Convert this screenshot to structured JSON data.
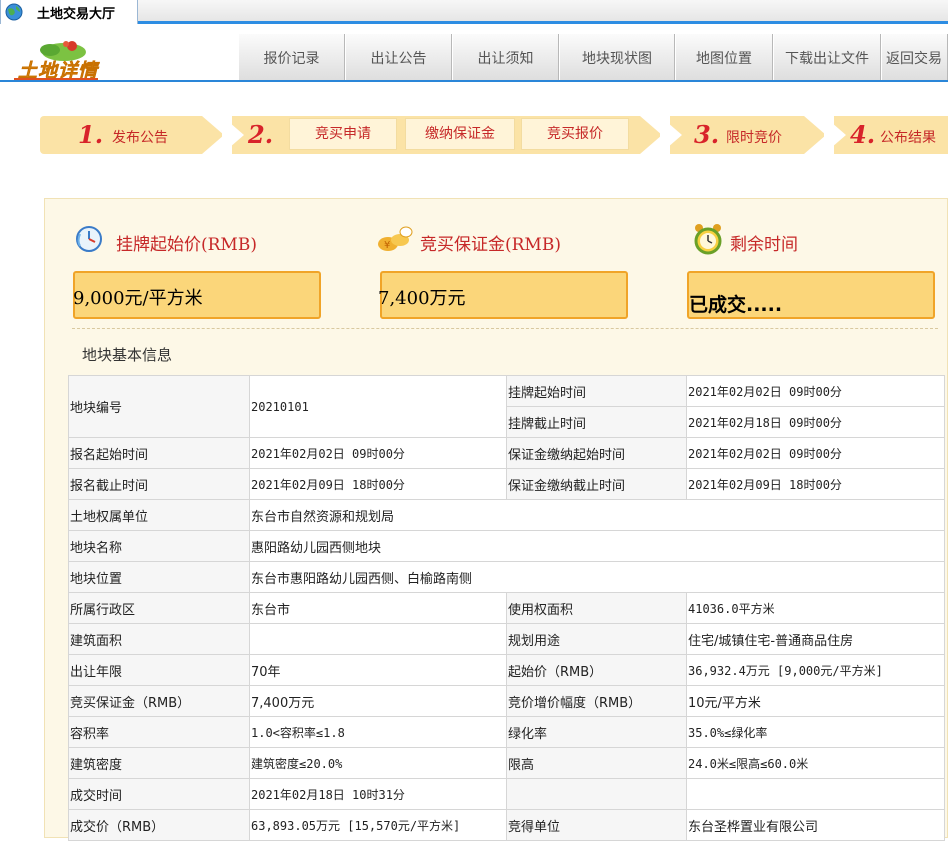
{
  "tab": {
    "title": "土地交易大厅"
  },
  "header": {
    "logo_text": "土地详情"
  },
  "nav": {
    "items": [
      {
        "label": "报价记录"
      },
      {
        "label": "出让公告"
      },
      {
        "label": "出让须知"
      },
      {
        "label": "地块现状图"
      },
      {
        "label": "地图位置"
      },
      {
        "label": "下载出让文件"
      },
      {
        "label": "返回交易"
      }
    ]
  },
  "steps": {
    "s1": {
      "num": "1.",
      "label": "发布公告"
    },
    "s2": {
      "num": "2.",
      "buttons": [
        "竞买申请",
        "缴纳保证金",
        "竞买报价"
      ]
    },
    "s3": {
      "num": "3.",
      "label": "限时竞价"
    },
    "s4": {
      "num": "4.",
      "label": "公布结果"
    }
  },
  "colors": {
    "accent": "#2a86d8",
    "step_bg": "#fbe3a6",
    "step_text": "#c62828",
    "box_fill": "#fbd67a",
    "box_border": "#f0a428"
  },
  "price": {
    "start_label": "挂牌起始价(RMB)",
    "start_value": "9,000元/平方米",
    "deposit_label": "竞买保证金(RMB)",
    "deposit_value": "7,400万元",
    "remaining_label": "剩余时间",
    "remaining_value": "已成交....."
  },
  "section": {
    "title": "地块基本信息"
  },
  "table": {
    "plot_no_label": "地块编号",
    "plot_no": "20210101",
    "list_start_label": "挂牌起始时间",
    "list_start": "2021年02月02日 09时00分",
    "list_end_label": "挂牌截止时间",
    "list_end": "2021年02月18日 09时00分",
    "reg_start_label": "报名起始时间",
    "reg_start": "2021年02月02日 09时00分",
    "dep_start_label": "保证金缴纳起始时间",
    "dep_start": "2021年02月02日 09时00分",
    "reg_end_label": "报名截止时间",
    "reg_end": "2021年02月09日 18时00分",
    "dep_end_label": "保证金缴纳截止时间",
    "dep_end": "2021年02月09日 18时00分",
    "owner_label": "土地权属单位",
    "owner": "东台市自然资源和规划局",
    "name_label": "地块名称",
    "name": "惠阳路幼儿园西侧地块",
    "location_label": "地块位置",
    "location": "东台市惠阳路幼儿园西侧、白榆路南侧",
    "district_label": "所属行政区",
    "district": "东台市",
    "area_label": "使用权面积",
    "area": "41036.0平方米",
    "build_area_label": "建筑面积",
    "build_area": "",
    "usage_label": "规划用途",
    "usage": "住宅/城镇住宅-普通商品住房",
    "years_label": "出让年限",
    "years": "70年",
    "start_price_label": "起始价（RMB）",
    "start_price": "36,932.4万元 [9,000元/平方米]",
    "deposit_label": "竞买保证金（RMB）",
    "deposit": "7,400万元",
    "increment_label": "竞价增价幅度（RMB）",
    "increment": "10元/平方米",
    "far_label": "容积率",
    "far": "1.0<容积率≤1.8",
    "green_label": "绿化率",
    "green": "35.0%≤绿化率",
    "density_label": "建筑密度",
    "density": "建筑密度≤20.0%",
    "height_label": "限高",
    "height": "24.0米≤限高≤60.0米",
    "deal_time_label": "成交时间",
    "deal_time": "2021年02月18日 10时31分",
    "deal_price_label": "成交价（RMB）",
    "deal_price": "63,893.05万元 [15,570元/平方米]",
    "winner_label": "竞得单位",
    "winner": "东台圣桦置业有限公司"
  }
}
